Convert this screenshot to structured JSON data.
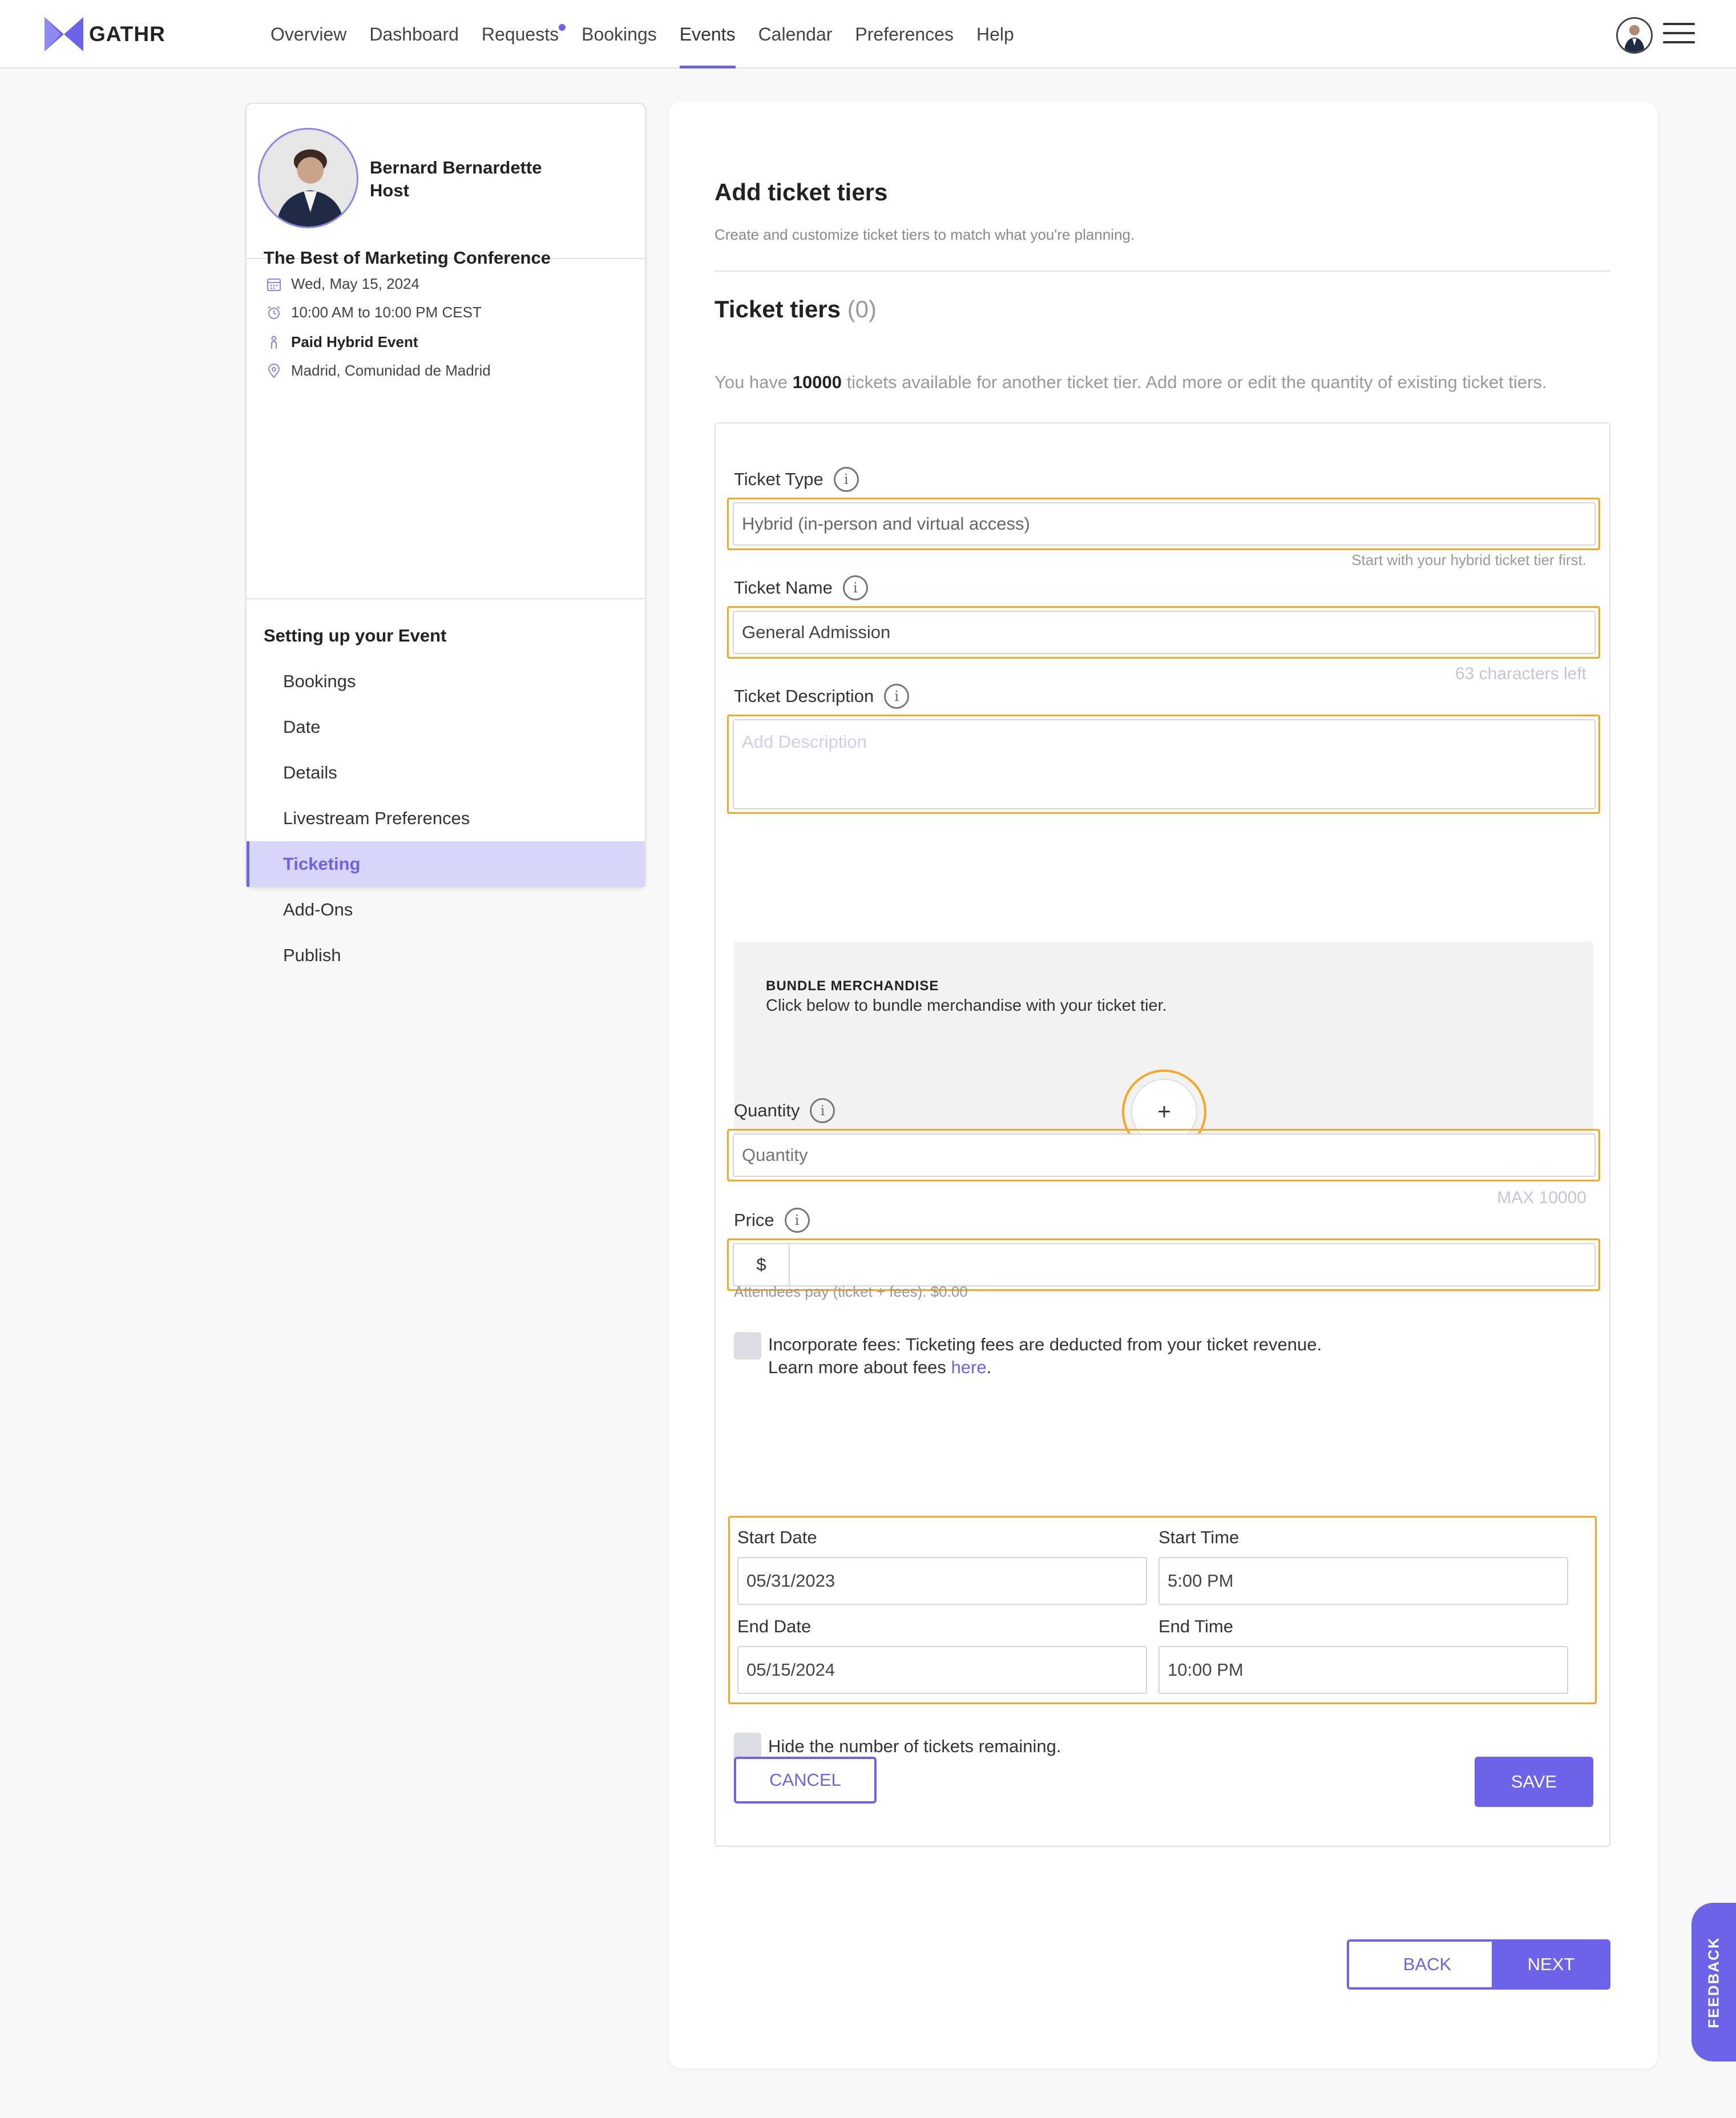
{
  "brand": {
    "name": "GATHR",
    "accent": "#6c63e8",
    "highlight": "#f5a623"
  },
  "nav": {
    "items": [
      {
        "label": "Overview"
      },
      {
        "label": "Dashboard"
      },
      {
        "label": "Requests"
      },
      {
        "label": "Bookings"
      },
      {
        "label": "Events"
      },
      {
        "label": "Calendar"
      },
      {
        "label": "Preferences"
      },
      {
        "label": "Help"
      }
    ],
    "active": "Events",
    "notification_on": "Requests"
  },
  "host": {
    "name": "Bernard Bernardette",
    "role": "Host"
  },
  "event": {
    "title": "The Best of Marketing Conference",
    "date": "Wed, May 15, 2024",
    "time": "10:00 AM to 10:00 PM CEST",
    "type": "Paid Hybrid Event",
    "location": "Madrid, Comunidad de Madrid"
  },
  "setup": {
    "title": "Setting up your Event",
    "steps": [
      {
        "label": "Bookings"
      },
      {
        "label": "Date"
      },
      {
        "label": "Details"
      },
      {
        "label": "Livestream Preferences"
      },
      {
        "label": "Ticketing"
      },
      {
        "label": "Add-Ons"
      },
      {
        "label": "Publish"
      }
    ],
    "active": "Ticketing"
  },
  "main": {
    "title": "Add ticket tiers",
    "subtitle": "Create and customize ticket tiers to match what you're planning.",
    "tiers_label": "Ticket tiers",
    "tiers_count": "(0)",
    "available_prefix": "You have",
    "available_count": "10000",
    "available_suffix": "tickets available for another ticket tier. Add more or edit the quantity of existing ticket tiers."
  },
  "form": {
    "ticket_type_label": "Ticket Type",
    "ticket_type_value": "Hybrid (in-person and virtual access)",
    "ticket_type_hint": "Start with your hybrid ticket tier first.",
    "ticket_name_label": "Ticket Name",
    "ticket_name_value": "General Admission",
    "ticket_name_hint": "63 characters left",
    "description_label": "Ticket Description",
    "description_placeholder": "Add Description",
    "bundle_title": "BUNDLE MERCHANDISE",
    "bundle_sub": "Click below to bundle merchandise with your ticket tier.",
    "bundle_plus": "+",
    "quantity_label": "Quantity",
    "quantity_placeholder": "Quantity",
    "quantity_hint": "MAX 10000",
    "price_label": "Price",
    "price_currency": "$",
    "price_value": "",
    "price_hint": "Attendees pay (ticket + fees): $0.00",
    "fees_text": "Incorporate fees: Ticketing fees are deducted from your ticket revenue.",
    "fees_learn": "Learn more about fees",
    "fees_link": "here",
    "fees_period": ".",
    "start_date_label": "Start Date",
    "start_date_value": "05/31/2023",
    "start_time_label": "Start Time",
    "start_time_value": "5:00 PM",
    "end_date_label": "End Date",
    "end_date_value": "05/15/2024",
    "end_time_label": "End Time",
    "end_time_value": "10:00 PM",
    "hide_remaining_text": "Hide the number of tickets remaining.",
    "cancel_label": "CANCEL",
    "save_label": "SAVE"
  },
  "footer_buttons": {
    "back": "BACK",
    "next": "NEXT"
  },
  "feedback_label": "FEEDBACK"
}
